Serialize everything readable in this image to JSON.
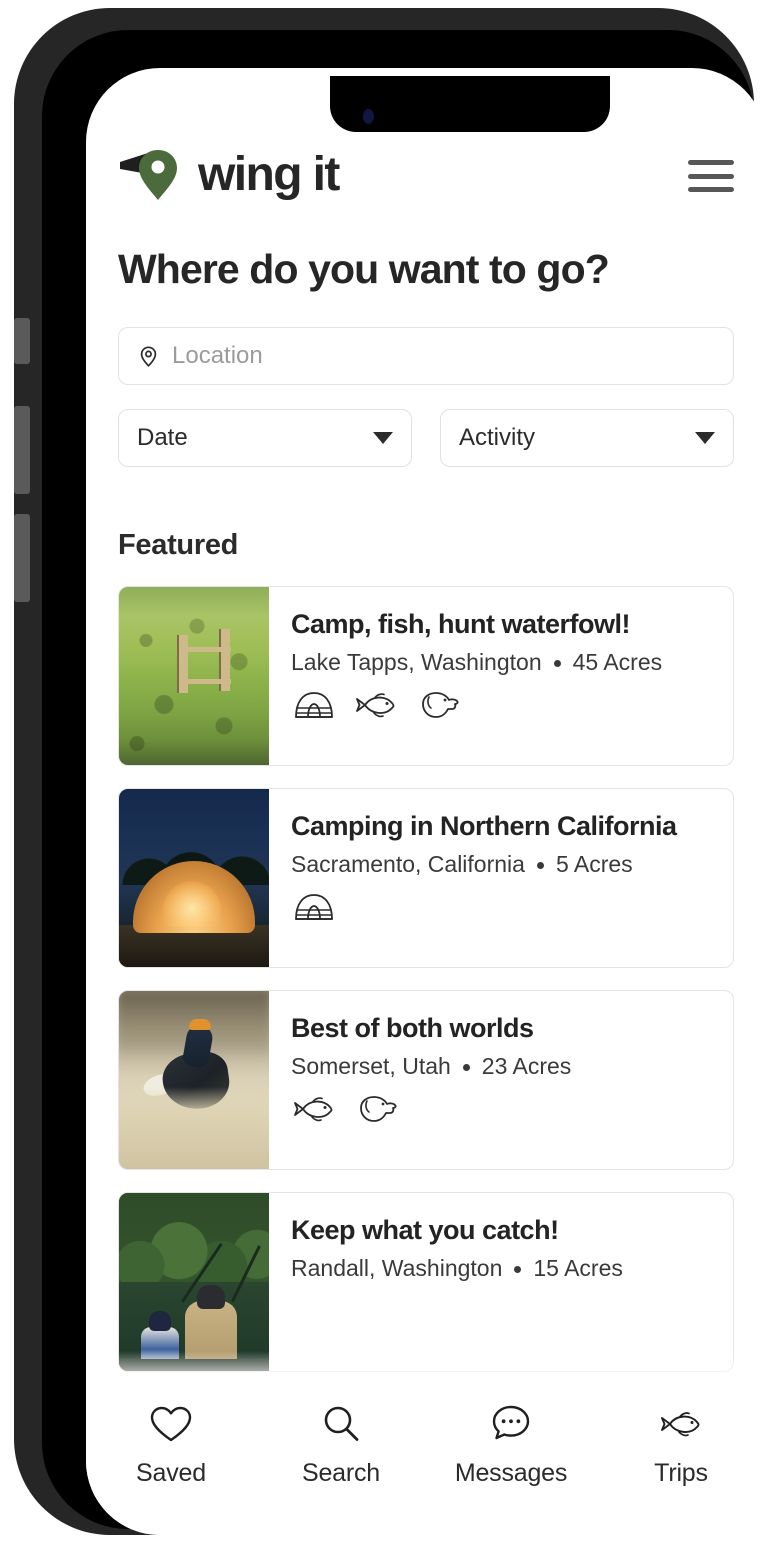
{
  "brand": {
    "name": "wing it",
    "mark_color": "#4c6b3c",
    "wing_color": "#1f1f1f"
  },
  "header": {
    "menu_label": "Menu"
  },
  "page": {
    "title": "Where do you want to go?"
  },
  "search": {
    "location": {
      "placeholder": "Location",
      "value": ""
    },
    "date": {
      "label": "Date"
    },
    "activity": {
      "label": "Activity"
    }
  },
  "featured": {
    "section_title": "Featured",
    "cards": [
      {
        "title": "Camp, fish, hunt waterfowl!",
        "location": "Lake Tapps, Washington",
        "size": "45 Acres",
        "activities": [
          "tent-icon",
          "fish-icon",
          "dog-icon"
        ],
        "thumb": "green-field-with-fence-posts"
      },
      {
        "title": "Camping in Northern California",
        "location": "Sacramento, California",
        "size": "5 Acres",
        "activities": [
          "tent-icon"
        ],
        "thumb": "lit-tent-at-dusk"
      },
      {
        "title": "Best of both worlds",
        "location": "Somerset, Utah",
        "size": "23 Acres",
        "activities": [
          "fish-icon",
          "dog-icon"
        ],
        "thumb": "grouse-in-dry-grass"
      },
      {
        "title": "Keep what you catch!",
        "location": "Randall, Washington",
        "size": "15 Acres",
        "activities": [],
        "thumb": "two-anglers-on-lake"
      }
    ]
  },
  "bottom_nav": {
    "items": [
      {
        "label": "Saved",
        "icon": "heart-icon"
      },
      {
        "label": "Search",
        "icon": "search-icon"
      },
      {
        "label": "Messages",
        "icon": "message-bubble-icon"
      },
      {
        "label": "Trips",
        "icon": "fish-icon"
      }
    ]
  },
  "colors": {
    "brand_green": "#4c6b3c",
    "text_primary": "#262626",
    "text_secondary": "#3a3a3a",
    "placeholder": "#9b9b9b",
    "border": "#e2e2e2",
    "device_bezel": "#262626",
    "camera_dot": "#111741"
  }
}
